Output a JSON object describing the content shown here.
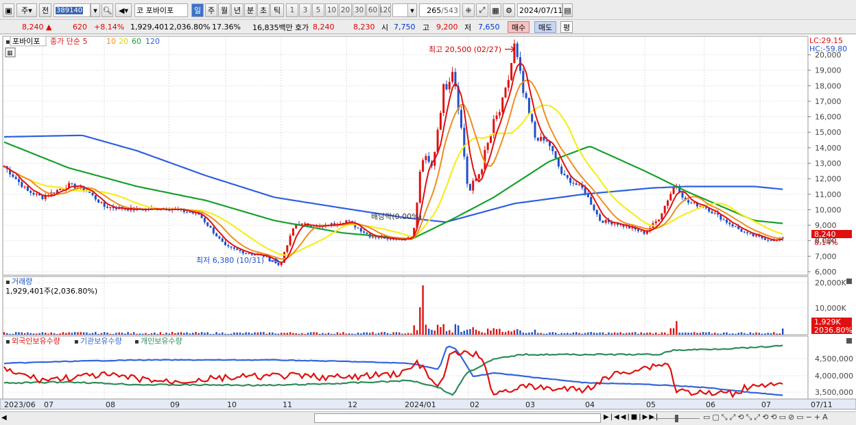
{
  "toolbar": {
    "market": "주",
    "prev": "전",
    "code": "389140",
    "name_prefix": "코",
    "name": "포바이포",
    "periods": [
      "일",
      "주",
      "월",
      "년",
      "분",
      "초",
      "틱"
    ],
    "active_period": "일",
    "intervals": [
      "1",
      "3",
      "5",
      "10",
      "20",
      "30",
      "60",
      "120"
    ],
    "count_current": "265",
    "count_total": "/543",
    "date": "2024/07/11"
  },
  "quote": {
    "price": "8,240",
    "change_arrow": "▲",
    "change": "620",
    "change_pct": "+8.14%",
    "volume": "1,929,401",
    "volume_pct": "2,036.80%",
    "turnover_pct": "17.36%",
    "amount": "16,835백만",
    "bid_label": "호가",
    "bid_ask1": "8,240",
    "bid_ask2": "8,230",
    "open_label": "시",
    "open": "7,750",
    "high_label": "고",
    "high": "9,200",
    "low_label": "저",
    "low": "7,650",
    "buy": "매수",
    "sell": "매도",
    "avg": "평"
  },
  "legend": {
    "stock": "포바이포",
    "price_label": "종가 단순",
    "ma_periods": [
      "5",
      "10",
      "20",
      "60",
      "120"
    ],
    "lc": "LC:29.15",
    "hc": "HC:-59.80",
    "price_box": "8,240",
    "pct_box": "8.14%",
    "high_note": "최고 20,500 (02/27)",
    "low_note": "최저 6,380 (10/31)",
    "dividend_note": "배당락(0.00%)"
  },
  "volume_panel": {
    "title": "거래량",
    "value": "1,929,401주(2,036.80%)",
    "box1": "1,929K",
    "box2": "2036.80%"
  },
  "holdings_panel": {
    "foreign": "외국인보유수량",
    "inst": "기관보유수량",
    "indiv": "개인보유수량"
  },
  "colors": {
    "price": "#e01010",
    "ma5": "#e01010",
    "ma10": "#f08c1e",
    "ma20": "#f5ee1e",
    "ma60": "#16a02a",
    "ma120": "#2e5fe0",
    "candle_up": "#e01010",
    "candle_down": "#1e50c8",
    "foreign": "#e01010",
    "inst": "#3264dc",
    "indiv": "#2e8b57"
  },
  "chart_data": [
    {
      "type": "line",
      "title": "",
      "y_axis_ticks": [
        "6,000",
        "7,000",
        "8,000",
        "9,000",
        "10,000",
        "11,000",
        "12,000",
        "13,000",
        "14,000",
        "15,000",
        "16,000",
        "17,000",
        "18,000",
        "19,000",
        "20,000"
      ],
      "x_axis_ticks": [
        "2023/06",
        "07",
        "08",
        "09",
        "10",
        "11",
        "12",
        "2024/01",
        "02",
        "03",
        "04",
        "05",
        "06",
        "07",
        "07/11"
      ],
      "ylim": [
        6000,
        20000
      ],
      "series": [
        {
          "name": "종가",
          "x": [
            "2023/06",
            "07",
            "08",
            "09",
            "10",
            "10/31",
            "11",
            "12",
            "2024/01",
            "02/27",
            "03",
            "04",
            "05",
            "06",
            "07",
            "07/11"
          ],
          "values": [
            12900,
            10800,
            10200,
            10100,
            7600,
            6380,
            9200,
            8600,
            8100,
            20500,
            14800,
            9100,
            8900,
            9300,
            8100,
            8240
          ]
        },
        {
          "name": "5",
          "values": []
        },
        {
          "name": "10",
          "values": []
        },
        {
          "name": "20",
          "values": []
        },
        {
          "name": "60",
          "values": []
        },
        {
          "name": "120",
          "values": []
        }
      ],
      "annotations": [
        {
          "text": "최고 20,500 (02/27)",
          "x": "02/27",
          "y": 20500
        },
        {
          "text": "최저 6,380 (10/31)",
          "x": "10/31",
          "y": 6380
        }
      ]
    },
    {
      "type": "bar",
      "title": "",
      "y_axis_ticks": [
        "10,000K",
        "20,000K"
      ],
      "series": [
        {
          "name": "거래량",
          "values": []
        }
      ]
    },
    {
      "type": "line",
      "title": "",
      "y_axis_ticks": [
        "3,500,000",
        "4,000,000",
        "4,500,000"
      ],
      "series": [
        {
          "name": "외국인보유수량",
          "values": []
        },
        {
          "name": "기관보유수량",
          "values": []
        },
        {
          "name": "개인보유수량",
          "values": []
        }
      ]
    }
  ]
}
